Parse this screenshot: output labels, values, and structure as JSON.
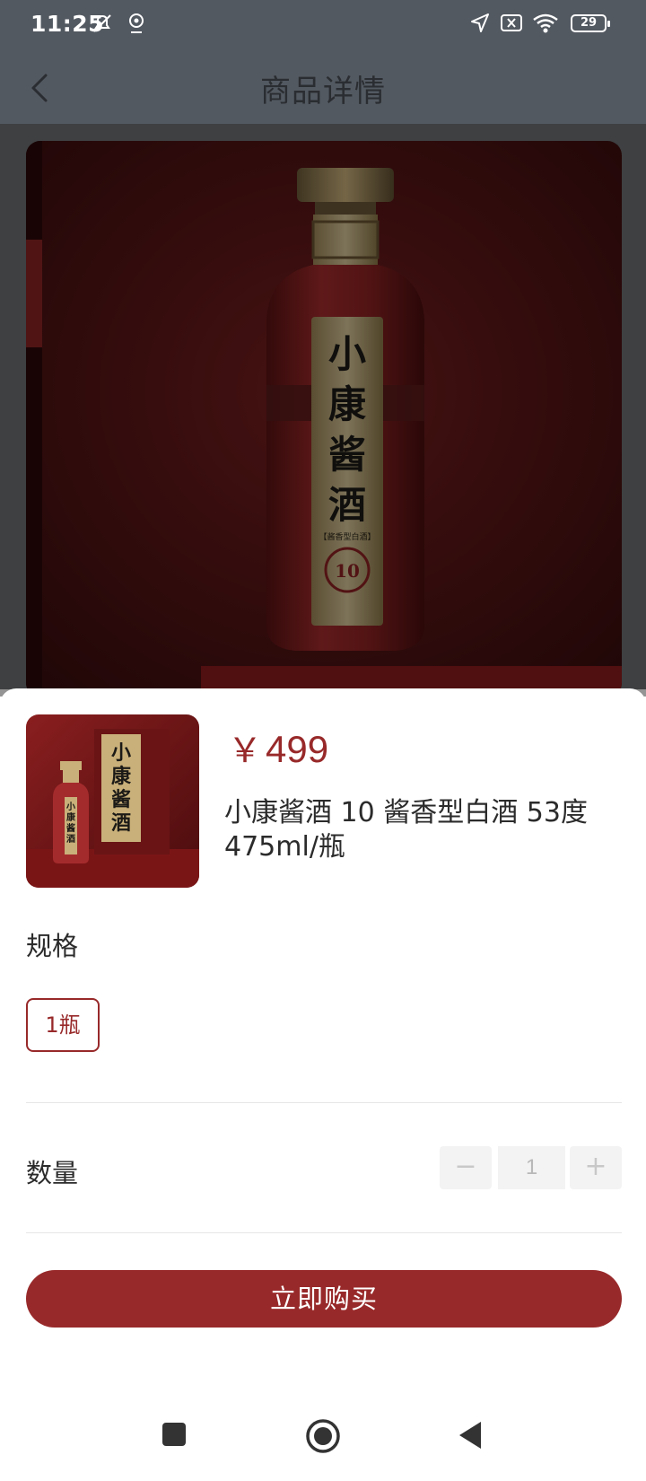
{
  "status_bar": {
    "time": "11:25",
    "battery": "29",
    "icons": [
      "mute-icon",
      "location-pin-icon",
      "navigation-arrow-icon",
      "no-sim-icon",
      "wifi-icon",
      "battery-icon"
    ]
  },
  "header": {
    "title": "商品详情",
    "back_icon": "chevron-left-icon"
  },
  "hero": {
    "bottle_label": [
      "小",
      "康",
      "酱",
      "酒"
    ],
    "bottle_subtitle": "【酱香型白酒】",
    "bottle_number": "10"
  },
  "product": {
    "currency": "￥",
    "price": "499",
    "name": "小康酱酒 10 酱香型白酒 53度 475ml/瓶",
    "thumb_label": [
      "小",
      "康",
      "酱",
      "酒"
    ]
  },
  "spec": {
    "label": "规格",
    "options": [
      "1瓶"
    ],
    "selected": "1瓶"
  },
  "quantity": {
    "label": "数量",
    "value": "1",
    "minus": "−",
    "plus": "+"
  },
  "buy_button": "立即购买",
  "colors": {
    "accent": "#98292a",
    "header_bg": "#535961"
  },
  "nav": {
    "icons": [
      "recent-apps-icon",
      "home-icon",
      "back-triangle-icon"
    ]
  }
}
